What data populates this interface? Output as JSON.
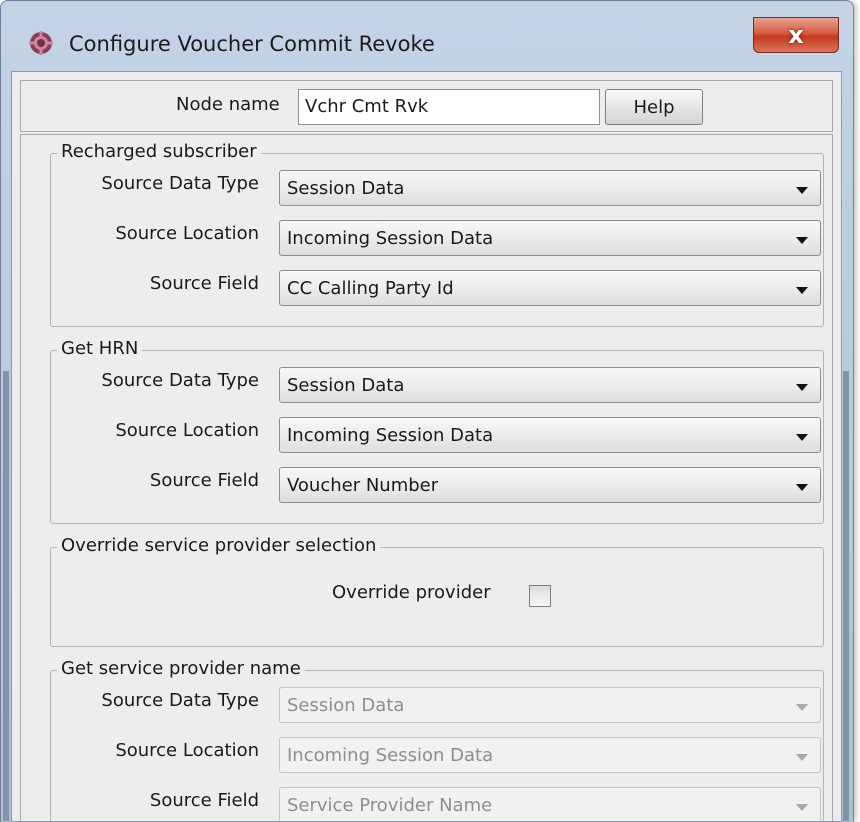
{
  "window": {
    "title": "Configure Voucher Commit Revoke",
    "close_label": "x",
    "icon": "app-gear-icon"
  },
  "node_row": {
    "label": "Node name",
    "value": "Vchr Cmt Rvk",
    "help_label": "Help"
  },
  "groups": {
    "recharged": {
      "title": "Recharged subscriber",
      "rows": [
        {
          "label": "Source Data Type",
          "value": "Session Data"
        },
        {
          "label": "Source Location",
          "value": "Incoming Session Data"
        },
        {
          "label": "Source Field",
          "value": "CC Calling Party Id"
        }
      ]
    },
    "hrn": {
      "title": "Get HRN",
      "rows": [
        {
          "label": "Source Data Type",
          "value": "Session Data"
        },
        {
          "label": "Source Location",
          "value": "Incoming Session Data"
        },
        {
          "label": "Source Field",
          "value": "Voucher Number"
        }
      ]
    },
    "override": {
      "title": "Override service provider selection",
      "checkbox_label": "Override provider",
      "checked": false
    },
    "sp_name": {
      "title": "Get service provider name",
      "enabled": false,
      "rows": [
        {
          "label": "Source Data Type",
          "value": "Session Data"
        },
        {
          "label": "Source Location",
          "value": "Incoming Session Data"
        },
        {
          "label": "Source Field",
          "value": "Service Provider Name"
        }
      ]
    }
  },
  "colors": {
    "client_bg": "#ededed",
    "frame": "#b7c8de",
    "close_button": "#c3391d",
    "disabled_text": "#8e8e8e"
  }
}
